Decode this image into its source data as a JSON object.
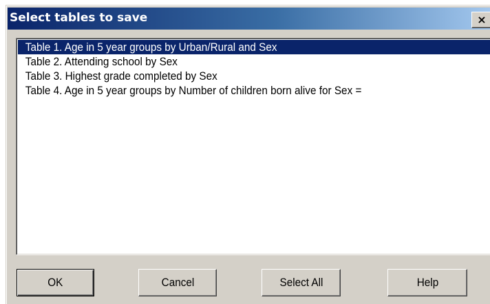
{
  "dialog": {
    "title": "Select tables to save",
    "close_label": "×"
  },
  "tables_list": {
    "items": [
      {
        "label": "Table 1. Age in 5 year groups by Urban/Rural and Sex",
        "selected": true
      },
      {
        "label": "Table 2. Attending school by Sex",
        "selected": false
      },
      {
        "label": "Table 3. Highest grade completed by Sex",
        "selected": false
      },
      {
        "label": "Table 4. Age in 5 year groups by Number of children born alive for Sex =",
        "selected": false
      }
    ]
  },
  "buttons": {
    "ok": "OK",
    "cancel": "Cancel",
    "select_all": "Select All",
    "help": "Help"
  },
  "colors": {
    "titlebar_start": "#0a246a",
    "titlebar_end": "#a6caf0",
    "selection": "#0a246a",
    "face": "#d4d0c8"
  }
}
